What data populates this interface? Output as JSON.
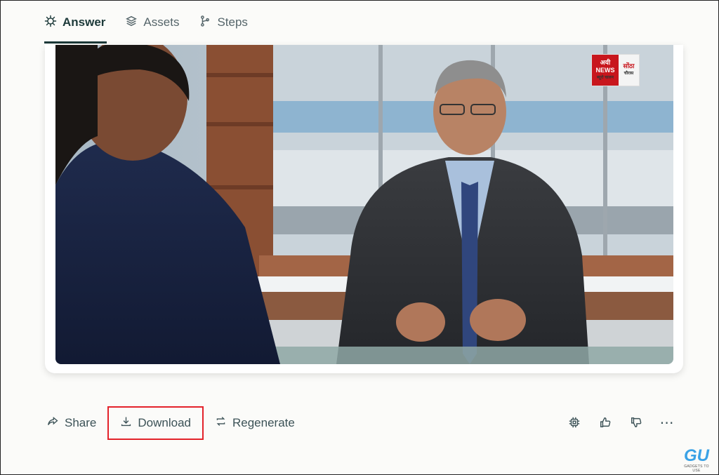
{
  "tabs": [
    {
      "label": "Answer",
      "icon": "spark-bug-icon",
      "active": true
    },
    {
      "label": "Assets",
      "icon": "layers-icon",
      "active": false
    },
    {
      "label": "Steps",
      "icon": "branch-icon",
      "active": false
    }
  ],
  "media": {
    "logo": {
      "left_line1": "अयी",
      "left_line2": "NEWS",
      "left_line3": "ब्यूरो चालन",
      "right_line1": "सोंठा",
      "right_line2": "चौरास"
    }
  },
  "actions": {
    "share": "Share",
    "download": "Download",
    "regenerate": "Regenerate"
  },
  "icons": [
    "chip-icon",
    "thumbs-up-icon",
    "thumbs-down-icon",
    "more-icon"
  ],
  "watermark": {
    "mark": "GU",
    "tagline": "GADGETS TO USE"
  },
  "colors": {
    "highlight": "#e3222a",
    "text": "#1f3a3a"
  }
}
